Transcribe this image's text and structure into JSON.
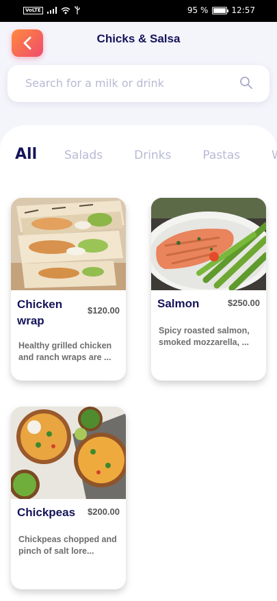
{
  "status_bar": {
    "volte": "VoLTE",
    "battery_percent": "95 %",
    "battery_level": 0.95,
    "time": "12:57"
  },
  "header": {
    "title": "Chicks & Salsa",
    "back_icon": "chevron-left-icon"
  },
  "search": {
    "placeholder": "Search for a milk or drink",
    "icon": "search-icon"
  },
  "tabs": [
    {
      "label": "All",
      "active": true
    },
    {
      "label": "Salads",
      "active": false
    },
    {
      "label": "Drinks",
      "active": false
    },
    {
      "label": "Pastas",
      "active": false
    },
    {
      "label": "W",
      "active": false
    }
  ],
  "items": [
    {
      "name": "Chicken wrap",
      "price": "$120.00",
      "description": "Healthy grilled chicken and ranch wraps are ..."
    },
    {
      "name": "Salmon",
      "price": "$250.00",
      "description": "Spicy roasted salmon, smoked mozzarella, ..."
    },
    {
      "name": "Chickpeas",
      "price": "$200.00",
      "description": "Chickpeas chopped and pinch of salt lore..."
    }
  ],
  "colors": {
    "accent_start": "#ff8a3d",
    "accent_end": "#ef4b6c",
    "title": "#14145a",
    "tab_inactive": "#b7bad5"
  }
}
